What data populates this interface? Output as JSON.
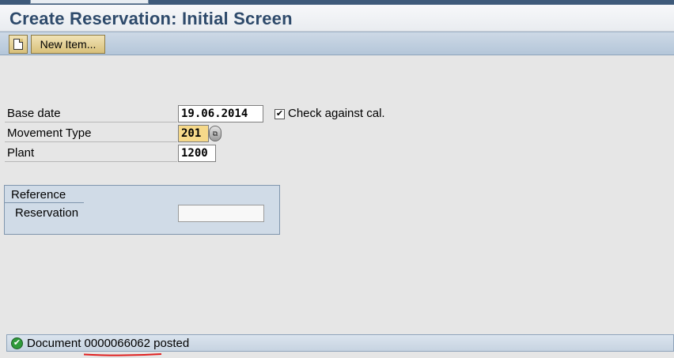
{
  "window": {
    "title": "Create Reservation: Initial Screen"
  },
  "toolbar": {
    "new_doc_icon": "document-icon",
    "new_item_label": "New Item..."
  },
  "form": {
    "base_date": {
      "label": "Base date",
      "value": "19.06.2014"
    },
    "check_against_cal": {
      "label": "Check against cal.",
      "checked": true,
      "mark": "✔"
    },
    "movement_type": {
      "label": "Movement Type",
      "value": "201",
      "help_icon": "⧉"
    },
    "plant": {
      "label": "Plant",
      "value": "1200"
    }
  },
  "reference": {
    "title": "Reference",
    "reservation_label": "Reservation",
    "reservation_value": ""
  },
  "status": {
    "icon": "✔",
    "prefix": "Document",
    "doc_number": "0000066062",
    "suffix": "posted"
  },
  "colors": {
    "title": "#2e4a6b",
    "toolbar": "#b4c6d9",
    "focused_field": "#f6d98a",
    "status_success": "#2f9a3a",
    "annotation_underline": "#e02020"
  }
}
